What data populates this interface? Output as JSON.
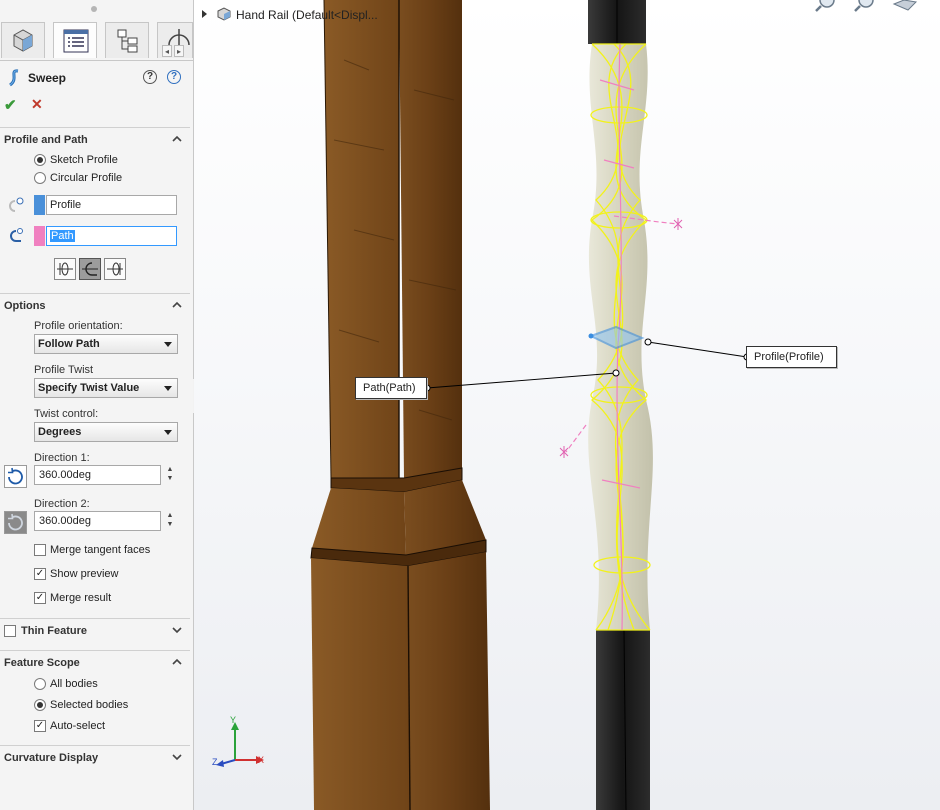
{
  "panel": {
    "feature_title": "Sweep",
    "help_icons": [
      "?",
      "?"
    ],
    "ok_symbol": "✔",
    "cancel_symbol": "✕"
  },
  "profile_path": {
    "title": "Profile and Path",
    "options": [
      {
        "label": "Sketch Profile",
        "selected": true
      },
      {
        "label": "Circular Profile",
        "selected": false
      }
    ],
    "profile_field": "Profile",
    "path_field": "Path",
    "profile_color": "#4a90d9",
    "path_color": "#f080c0"
  },
  "options": {
    "title": "Options",
    "orientation_label": "Profile orientation:",
    "orientation_value": "Follow Path",
    "twist_label": "Profile Twist",
    "twist_value": "Specify Twist Value",
    "twist_control_label": "Twist control:",
    "twist_control_value": "Degrees",
    "direction1_label": "Direction 1:",
    "direction1_value": "360.00deg",
    "direction2_label": "Direction 2:",
    "direction2_value": "360.00deg",
    "checks": [
      {
        "label": "Merge tangent faces",
        "checked": false
      },
      {
        "label": "Show preview",
        "checked": true
      },
      {
        "label": "Merge result",
        "checked": true
      }
    ]
  },
  "thin_feature": {
    "title": "Thin Feature",
    "checked": false
  },
  "feature_scope": {
    "title": "Feature Scope",
    "options": [
      {
        "label": "All bodies",
        "selected": false
      },
      {
        "label": "Selected bodies",
        "selected": true
      }
    ],
    "auto_select": {
      "label": "Auto-select",
      "checked": true
    }
  },
  "curvature": {
    "title": "Curvature Display"
  },
  "viewport": {
    "tree_item": "Hand Rail  (Default<Displ...",
    "callout_path": "Path(Path)",
    "callout_profile": "Profile(Profile)",
    "triad": {
      "x": "X",
      "y": "Y",
      "z": "Z"
    },
    "colors": {
      "wood": "#6b4218",
      "highlight": "#f2f21a",
      "sketch_path": "#f080c0",
      "sketch_profile": "#4a90d9",
      "metal": "#1c1c1c"
    }
  }
}
